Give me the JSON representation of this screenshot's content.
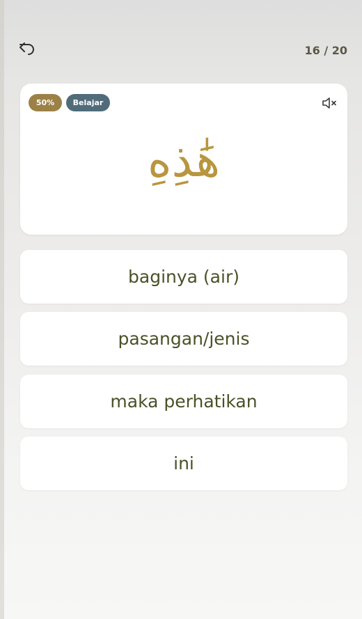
{
  "header": {
    "back_icon": "undo-arrow-icon",
    "progress": "16 / 20"
  },
  "card": {
    "percent_badge": "50%",
    "mode_badge": "Belajar",
    "mute_icon": "speaker-muted-icon",
    "arabic_word": "هَٰذِهِ"
  },
  "options": [
    {
      "label": "baginya (air)"
    },
    {
      "label": "pasangan/jenis"
    },
    {
      "label": "maka perhatikan"
    },
    {
      "label": "ini"
    }
  ],
  "colors": {
    "accent_gold": "#b8963f",
    "badge_gold": "#9c8147",
    "badge_slate": "#506b79",
    "option_text": "#4a5127"
  }
}
